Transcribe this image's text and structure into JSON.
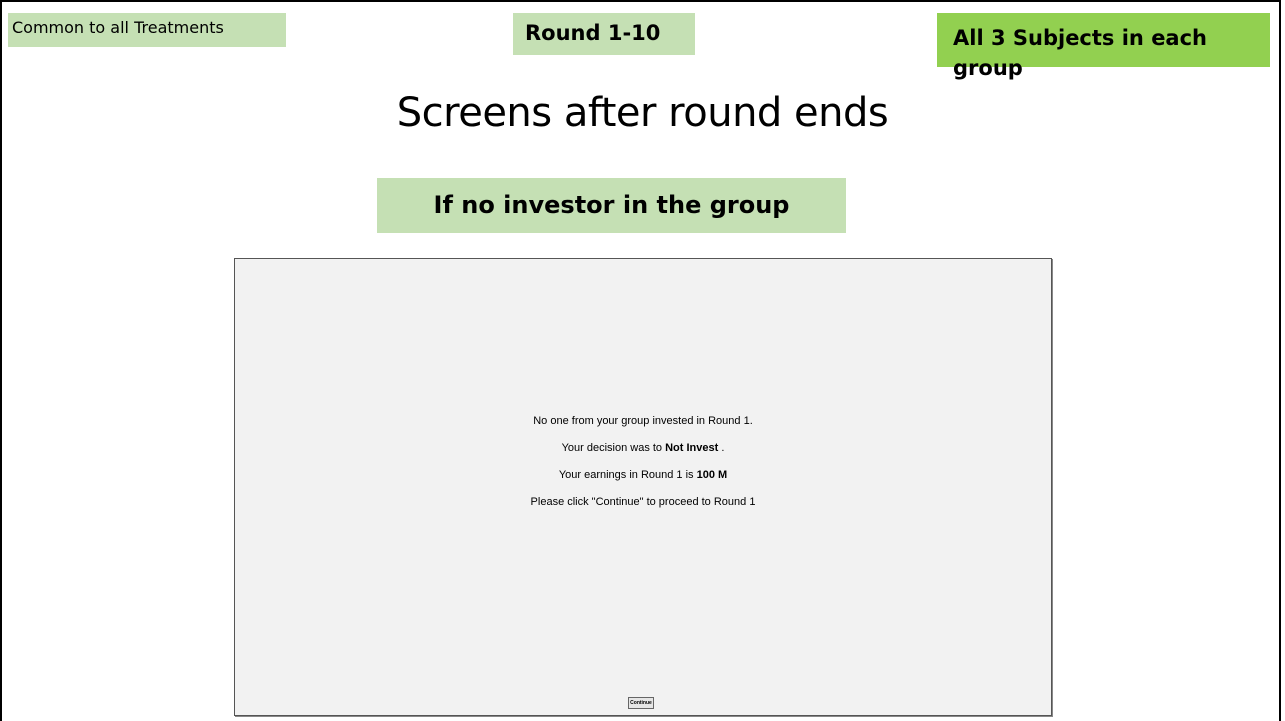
{
  "tags": {
    "common": "Common to all Treatments",
    "rounds": "Round 1-10",
    "subjects": "All 3 Subjects in each group"
  },
  "title": "Screens after round ends",
  "subheading": "If no investor in the group",
  "screen": {
    "line1": "No one from your group invested in Round 1.",
    "line2_prefix": "Your decision was to ",
    "line2_value": "Not Invest",
    "line2_suffix": " .",
    "line3_prefix": "Your earnings in Round 1 is ",
    "line3_value": "100 M",
    "line4": "Please click \"Continue\" to proceed to Round 1",
    "continue_label": "Continue"
  },
  "colors": {
    "light_green": "#c5e0b4",
    "bright_green": "#92d050",
    "screen_bg": "#f2f2f2"
  }
}
